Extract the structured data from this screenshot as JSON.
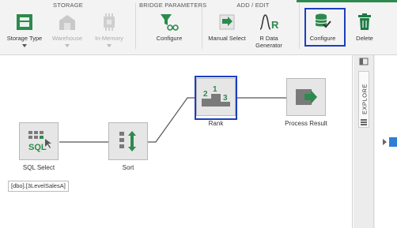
{
  "ribbon": {
    "groups": {
      "storage": "STORAGE",
      "bridge": "BRIDGE PARAMETERS",
      "add_edit": "ADD / EDIT"
    },
    "buttons": {
      "storage_type": "Storage Type",
      "warehouse": "Warehouse",
      "in_memory": "In-Memory",
      "bridge_configure": "Configure",
      "manual_select": "Manual Select",
      "r_data_generator": "R Data\nGenerator",
      "configure": "Configure",
      "delete": "Delete"
    }
  },
  "canvas": {
    "nodes": {
      "sql_select": "SQL Select",
      "sort": "Sort",
      "rank": "Rank",
      "process_result": "Process Result"
    },
    "rank_digits": [
      "2",
      "1",
      "3"
    ],
    "tooltip": "[dbo].[3LevelSalesA]"
  },
  "right_panel": {
    "explore": "EXPLORE"
  },
  "colors": {
    "accent_green": "#2d8a4e",
    "highlight_blue": "#1a3fbf",
    "delete_green": "#1e7a45"
  }
}
